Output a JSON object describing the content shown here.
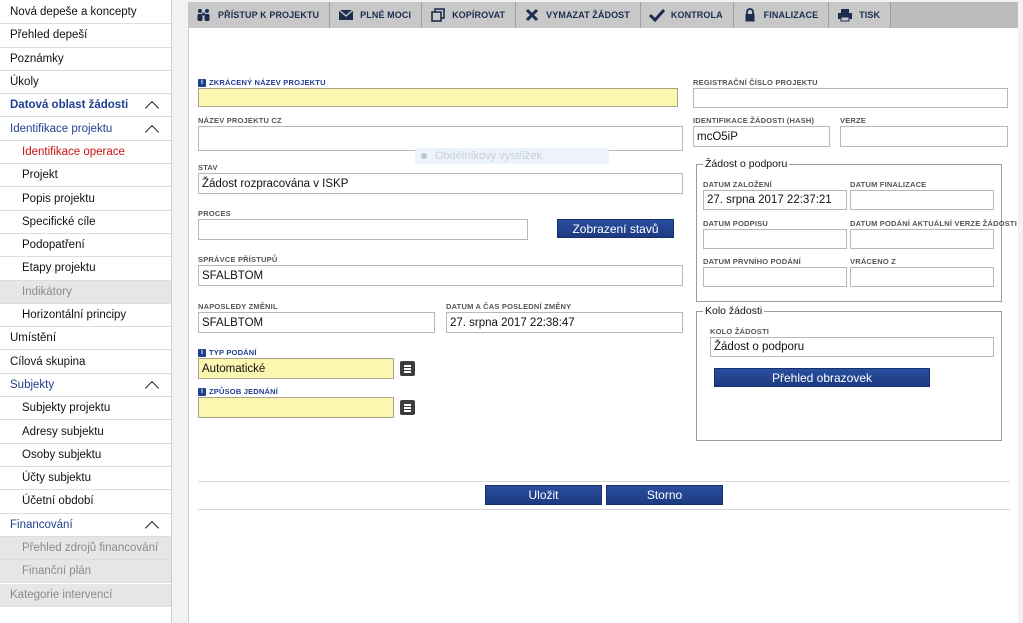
{
  "sidebar": {
    "items": [
      {
        "label": "Nová depeše a koncepty",
        "kind": "top"
      },
      {
        "label": "Přehled depeší",
        "kind": "top"
      },
      {
        "label": "Poznámky",
        "kind": "top"
      },
      {
        "label": "Úkoly",
        "kind": "top"
      },
      {
        "label": "Datová oblast žádosti",
        "kind": "section",
        "chevron": true
      },
      {
        "label": "Identifikace projektu",
        "kind": "section-light",
        "chevron": true
      },
      {
        "label": "Identifikace operace",
        "kind": "sub-active"
      },
      {
        "label": "Projekt",
        "kind": "sub"
      },
      {
        "label": "Popis projektu",
        "kind": "sub"
      },
      {
        "label": "Specifické cíle",
        "kind": "sub"
      },
      {
        "label": "Podopatření",
        "kind": "sub"
      },
      {
        "label": "Etapy projektu",
        "kind": "sub"
      },
      {
        "label": "Indikátory",
        "kind": "sub-disabled"
      },
      {
        "label": "Horizontální principy",
        "kind": "sub"
      },
      {
        "label": "Umístění",
        "kind": "top"
      },
      {
        "label": "Cílová skupina",
        "kind": "top"
      },
      {
        "label": "Subjekty",
        "kind": "section-light",
        "chevron": true
      },
      {
        "label": "Subjekty projektu",
        "kind": "sub"
      },
      {
        "label": "Adresy subjektu",
        "kind": "sub"
      },
      {
        "label": "Osoby subjektu",
        "kind": "sub"
      },
      {
        "label": "Účty subjektu",
        "kind": "sub"
      },
      {
        "label": "Účetní období",
        "kind": "sub"
      },
      {
        "label": "Financování",
        "kind": "section-light",
        "chevron": true
      },
      {
        "label": "Přehled zdrojů financování",
        "kind": "sub-disabled"
      },
      {
        "label": "Finanční plán",
        "kind": "sub-disabled"
      },
      {
        "label": "Kategorie intervencí",
        "kind": "top-disabled"
      }
    ]
  },
  "toolbar": {
    "buttons": [
      {
        "label": "Přístup k projektu",
        "icon": "people-icon"
      },
      {
        "label": "Plné moci",
        "icon": "envelope-icon"
      },
      {
        "label": "Kopírovat",
        "icon": "copy-icon"
      },
      {
        "label": "Vymazat žádost",
        "icon": "cross-icon"
      },
      {
        "label": "Kontrola",
        "icon": "check-icon"
      },
      {
        "label": "Finalizace",
        "icon": "lock-icon"
      },
      {
        "label": "Tisk",
        "icon": "printer-icon"
      }
    ]
  },
  "form": {
    "zkraceny_nazev": {
      "label": "Zkrácený název projektu",
      "value": ""
    },
    "nazev_cz": {
      "label": "Název projektu CZ",
      "value": ""
    },
    "stav": {
      "label": "Stav",
      "value": "Žádost rozpracována v ISKP"
    },
    "tooltip": "Obdélníkový výstřižek",
    "proces": {
      "label": "Proces",
      "value": ""
    },
    "zobrazeni_stavu_label": "Zobrazení stavů",
    "spravce": {
      "label": "Správce přístupů",
      "value": "SFALBTOM"
    },
    "naposledy_zmenil": {
      "label": "Naposledy změnil",
      "value": "SFALBTOM"
    },
    "datum_zmeny": {
      "label": "Datum a čas poslední změny",
      "value": "27. srpna 2017 22:38:47"
    },
    "typ_podani": {
      "label": "Typ podání",
      "value": "Automatické"
    },
    "zpusob_jednani": {
      "label": "Způsob jednání",
      "value": ""
    },
    "registracni_cislo": {
      "label": "Registrační číslo projektu",
      "value": ""
    },
    "identifikace_hash": {
      "label": "Identifikace žádosti (hash)",
      "value": "mcO5iP"
    },
    "verze": {
      "label": "Verze",
      "value": ""
    },
    "zadost_group": {
      "title": "Žádost o podporu",
      "datum_zalozeni": {
        "label": "Datum založení",
        "value": "27. srpna 2017 22:37:21"
      },
      "datum_finalizace": {
        "label": "Datum finalizace",
        "value": ""
      },
      "datum_podpisu": {
        "label": "Datum podpisu",
        "value": ""
      },
      "datum_podani_aktualni": {
        "label": "Datum podání aktuální verze žádosti",
        "value": ""
      },
      "datum_prvniho_podani": {
        "label": "Datum prvního podání",
        "value": ""
      },
      "vraceno_z": {
        "label": "Vráceno z",
        "value": ""
      }
    },
    "kolo_group": {
      "title": "Kolo žádosti",
      "kolo_zadosti": {
        "label": "Kolo žádosti",
        "value": "Žádost o podporu"
      },
      "prehled_obrazovek_label": "Přehled obrazovek"
    },
    "ulozit_label": "Uložit",
    "storno_label": "Storno"
  },
  "colors": {
    "accent": "#1f3f8f",
    "required_field": "#fbf7b0",
    "active_item": "#cc1111"
  }
}
